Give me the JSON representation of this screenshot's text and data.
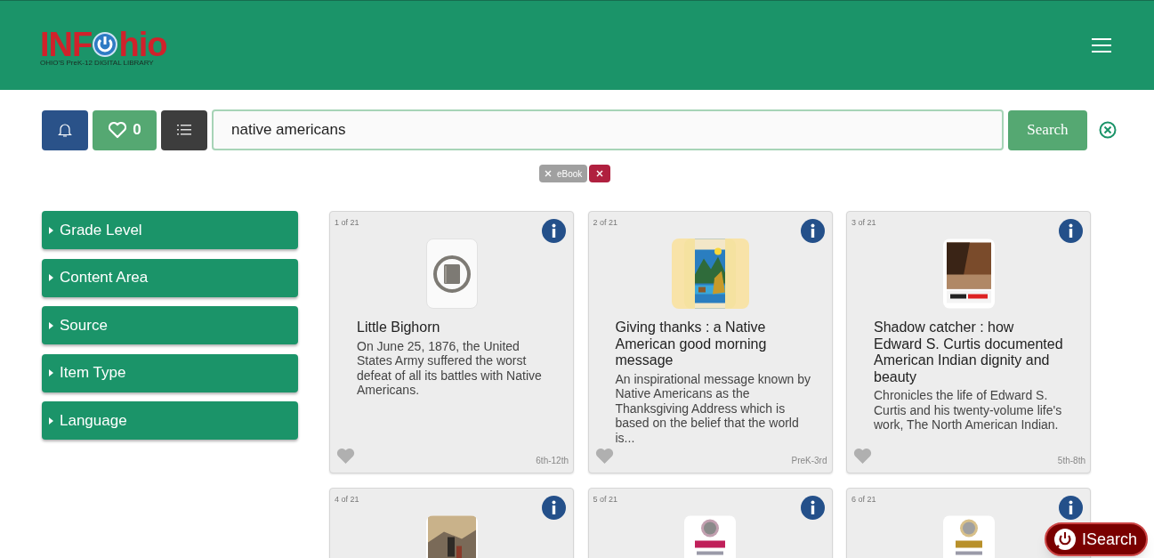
{
  "header": {
    "logo": {
      "left": "INF",
      "right": "hio",
      "tagline": "OHIO'S PreK-12 DIGITAL LIBRARY"
    }
  },
  "toolbar": {
    "favorites_count": "0",
    "search": {
      "value": "native americans",
      "button": "Search"
    }
  },
  "filter_chips": [
    {
      "label": "eBook",
      "kind": "filter"
    },
    {
      "kind": "clear"
    }
  ],
  "sidebar": {
    "items": [
      {
        "label": "Grade Level",
        "expanded": false
      },
      {
        "label": "Content Area",
        "expanded": false
      },
      {
        "label": "Source",
        "expanded": false
      },
      {
        "label": "Item Type",
        "expanded": false
      },
      {
        "label": "Language",
        "expanded": false
      }
    ]
  },
  "results": [
    {
      "counter": "1 of 21",
      "kind": "icon",
      "title": "Little Bighorn",
      "description": "On June 25, 1876, the United States Army suffered the worst defeat of all its battles with Native Americans.",
      "grade": "6th-12th",
      "favorite": false
    },
    {
      "counter": "2 of 21",
      "kind": "picture",
      "title": "Giving thanks : a Native American good morning message",
      "description": "An inspirational message known by Native Americans as the Thanksgiving Address which is based on the belief that the world is...",
      "grade": "PreK-3rd",
      "favorite": false
    },
    {
      "counter": "3 of 21",
      "kind": "picture",
      "title": "Shadow catcher : how Edward S. Curtis documented American Indian dignity and beauty",
      "description": "Chronicles the life of Edward S. Curtis and his twenty-volume life's work, The North American Indian.",
      "grade": "5th-8th",
      "favorite": false
    },
    {
      "counter": "4 of 21",
      "kind": "picture"
    },
    {
      "counter": "5 of 21",
      "kind": "picture"
    },
    {
      "counter": "6 of 21",
      "kind": "picture"
    }
  ],
  "isearch_button": "ISearch"
}
